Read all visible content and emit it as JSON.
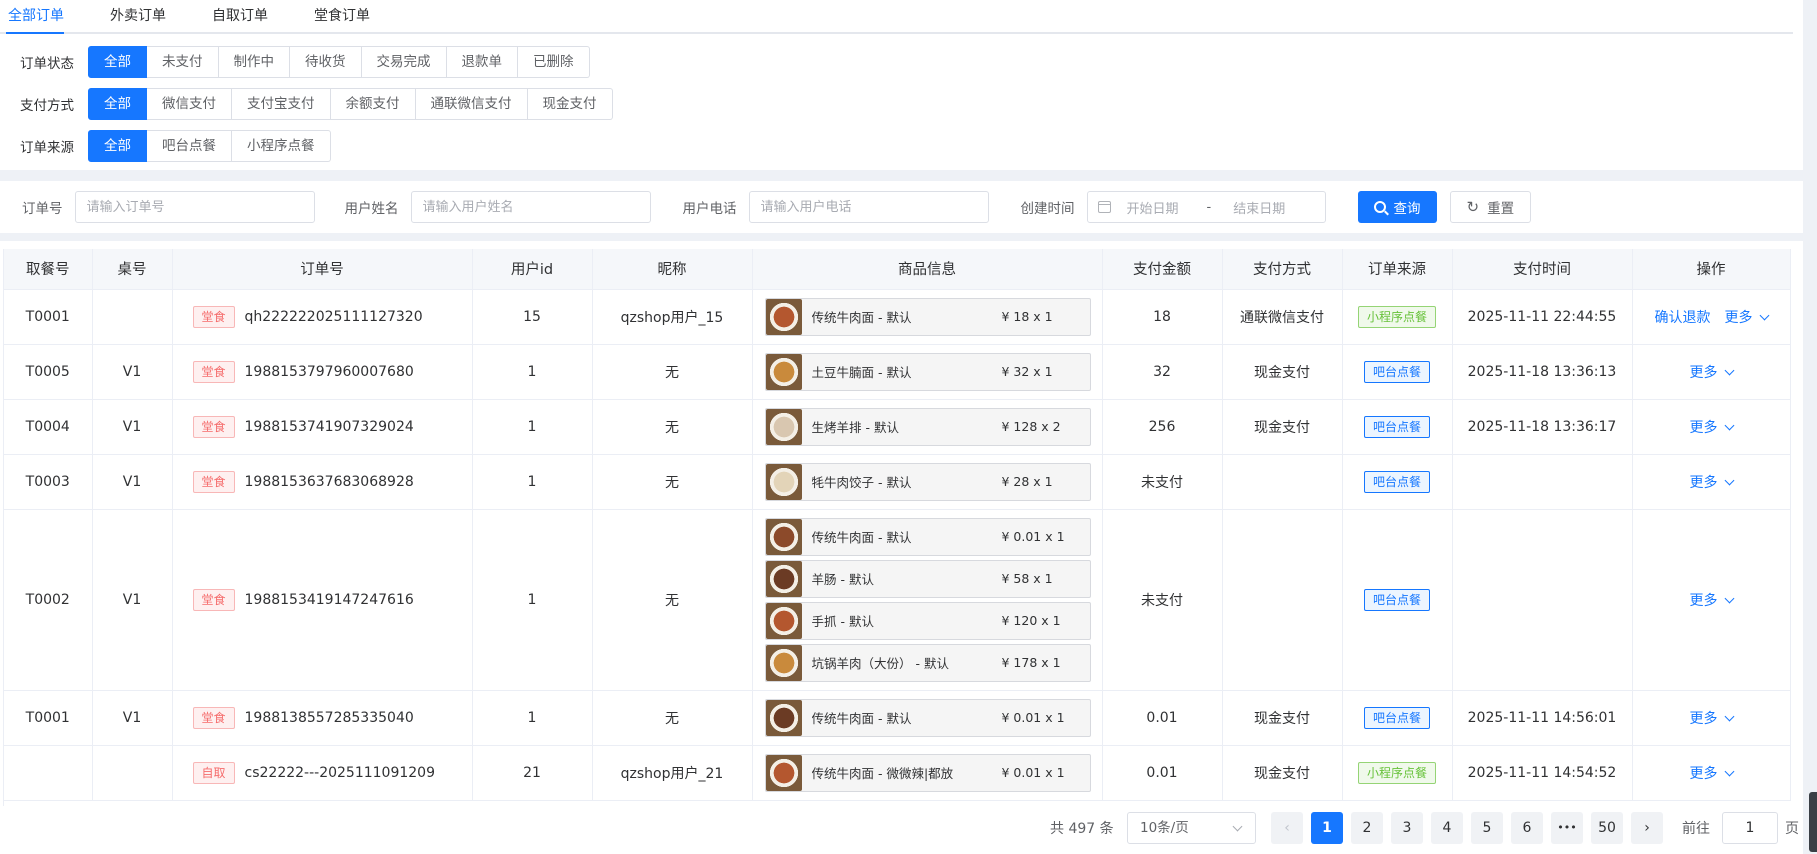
{
  "tabs": [
    "全部订单",
    "外卖订单",
    "自取订单",
    "堂食订单"
  ],
  "filters": {
    "status": {
      "label": "订单状态",
      "options": [
        "全部",
        "未支付",
        "制作中",
        "待收货",
        "交易完成",
        "退款单",
        "已删除"
      ]
    },
    "payment": {
      "label": "支付方式",
      "options": [
        "全部",
        "微信支付",
        "支付宝支付",
        "余额支付",
        "通联微信支付",
        "现金支付"
      ]
    },
    "source": {
      "label": "订单来源",
      "options": [
        "全部",
        "吧台点餐",
        "小程序点餐"
      ]
    }
  },
  "search": {
    "order_label": "订单号",
    "order_placeholder": "请输入订单号",
    "name_label": "用户姓名",
    "name_placeholder": "请输入用户姓名",
    "phone_label": "用户电话",
    "phone_placeholder": "请输入用户电话",
    "time_label": "创建时间",
    "start_placeholder": "开始日期",
    "sep": "-",
    "end_placeholder": "结束日期",
    "query_label": "查询",
    "reset_label": "重置"
  },
  "table": {
    "columns": [
      "取餐号",
      "桌号",
      "订单号",
      "用户id",
      "昵称",
      "商品信息",
      "支付金额",
      "支付方式",
      "订单来源",
      "支付时间",
      "操作"
    ],
    "rows": [
      {
        "pickup": "T0001",
        "table": "",
        "type_tag": "堂食",
        "order_no": "qh222222025111127320",
        "uid": "15",
        "nick": "qzshop用户_15",
        "goods": [
          {
            "name": "传统牛肉面 - 默认",
            "price": "¥ 18 x 1"
          }
        ],
        "amount": "18",
        "pay": "通联微信支付",
        "source": "小程序点餐",
        "time": "2025-11-11 22:44:55",
        "action": "确认退款",
        "more": "更多"
      },
      {
        "pickup": "T0005",
        "table": "V1",
        "type_tag": "堂食",
        "order_no": "1988153797960007680",
        "uid": "1",
        "nick": "无",
        "goods": [
          {
            "name": "土豆牛腩面 - 默认",
            "price": "¥ 32 x 1"
          }
        ],
        "amount": "32",
        "pay": "现金支付",
        "source": "吧台点餐",
        "time": "2025-11-18 13:36:13",
        "action": "",
        "more": "更多"
      },
      {
        "pickup": "T0004",
        "table": "V1",
        "type_tag": "堂食",
        "order_no": "1988153741907329024",
        "uid": "1",
        "nick": "无",
        "goods": [
          {
            "name": "生烤羊排 - 默认",
            "price": "¥ 128 x 2"
          }
        ],
        "amount": "256",
        "pay": "现金支付",
        "source": "吧台点餐",
        "time": "2025-11-18 13:36:17",
        "action": "",
        "more": "更多"
      },
      {
        "pickup": "T0003",
        "table": "V1",
        "type_tag": "堂食",
        "order_no": "1988153637683068928",
        "uid": "1",
        "nick": "无",
        "goods": [
          {
            "name": "牦牛肉饺子 - 默认",
            "price": "¥ 28 x 1"
          }
        ],
        "amount": "未支付",
        "pay": "",
        "source": "吧台点餐",
        "time": "",
        "action": "",
        "more": "更多"
      },
      {
        "pickup": "T0002",
        "table": "V1",
        "type_tag": "堂食",
        "order_no": "1988153419147247616",
        "uid": "1",
        "nick": "无",
        "goods": [
          {
            "name": "传统牛肉面 - 默认",
            "price": "¥ 0.01 x 1"
          },
          {
            "name": "羊肠 - 默认",
            "price": "¥ 58 x 1"
          },
          {
            "name": "手抓 - 默认",
            "price": "¥ 120 x 1"
          },
          {
            "name": "坑锅羊肉（大份） - 默认",
            "price": "¥ 178 x 1"
          }
        ],
        "amount": "未支付",
        "pay": "",
        "source": "吧台点餐",
        "time": "",
        "action": "",
        "more": "更多"
      },
      {
        "pickup": "T0001",
        "table": "V1",
        "type_tag": "堂食",
        "order_no": "1988138557285335040",
        "uid": "1",
        "nick": "无",
        "goods": [
          {
            "name": "传统牛肉面 - 默认",
            "price": "¥ 0.01 x 1"
          }
        ],
        "amount": "0.01",
        "pay": "现金支付",
        "source": "吧台点餐",
        "time": "2025-11-11 14:56:01",
        "action": "",
        "more": "更多"
      },
      {
        "pickup": "",
        "table": "",
        "type_tag": "自取",
        "order_no": "cs22222---2025111091209",
        "uid": "21",
        "nick": "qzshop用户_21",
        "goods": [
          {
            "name": "传统牛肉面 - 微微辣|都放",
            "price": "¥ 0.01 x 1"
          }
        ],
        "amount": "0.01",
        "pay": "现金支付",
        "source": "小程序点餐",
        "time": "2025-11-11 14:54:52",
        "action": "",
        "more": "更多"
      }
    ]
  },
  "pagination": {
    "total": "共 497 条",
    "page_size": "10条/页",
    "pages": [
      "1",
      "2",
      "3",
      "4",
      "5",
      "6",
      "•••",
      "50"
    ],
    "current": "1",
    "goto_label": "前往",
    "goto_value": "1",
    "page_suffix": "页"
  },
  "colors": {
    "primary": "#1677ff",
    "tag_red": "#f56c6c",
    "tag_green": "#67c23a"
  }
}
